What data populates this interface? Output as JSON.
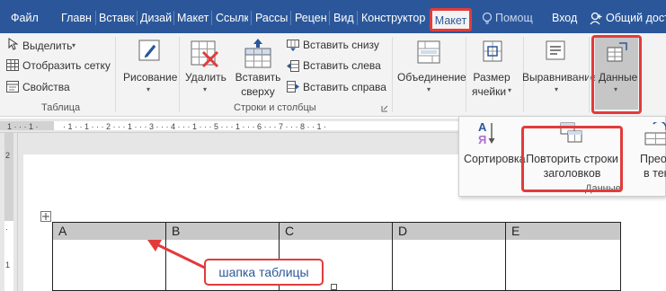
{
  "tabs": {
    "file": "Файл",
    "home": "Главн",
    "insert": "Вставк",
    "design": "Дизай",
    "layout1": "Макет",
    "references": "Ссылк",
    "mailings": "Рассы",
    "review": "Рецен",
    "view": "Вид",
    "constructor": "Конструктор",
    "layout_active": "Макет",
    "help": "Помощ",
    "login": "Вход",
    "share": "Общий дост"
  },
  "ribbon": {
    "select": "Выделить",
    "grid": "Отобразить сетку",
    "properties": "Свойства",
    "group_table": "Таблица",
    "draw": "Рисование",
    "delete": "Удалить",
    "insert_above_line1": "Вставить",
    "insert_above_line2": "сверху",
    "insert_below": "Вставить снизу",
    "insert_left": "Вставить слева",
    "insert_right": "Вставить справа",
    "group_rows_cols": "Строки и столбцы",
    "merge": "Объединение",
    "cell_size_line1": "Размер",
    "cell_size_line2": "ячейки",
    "alignment": "Выравнивание",
    "data": "Данные"
  },
  "panel": {
    "sort": "Сортировка",
    "repeat_line1": "Повторить строки",
    "repeat_line2": "заголовков",
    "convert_line1": "Преобра",
    "convert_line2": "в тек",
    "group_data": "Данные"
  },
  "table": {
    "headers": [
      "A",
      "B",
      "C",
      "D",
      "E"
    ]
  },
  "annotation": {
    "label": "шапка таблицы",
    "accent": "#e23b3b"
  }
}
